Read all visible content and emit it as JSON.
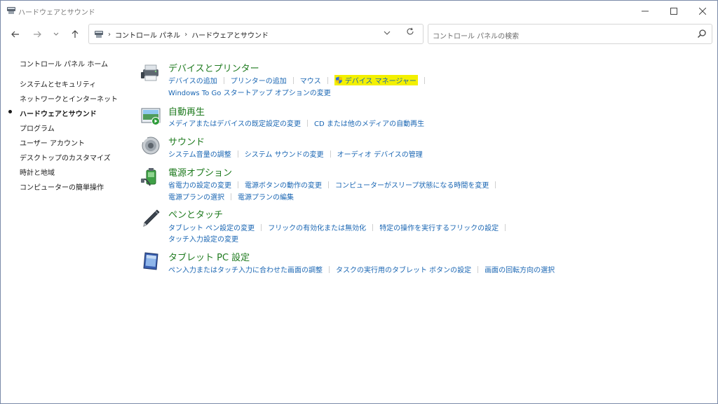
{
  "window": {
    "title": "ハードウェアとサウンド"
  },
  "address": {
    "crumbs": [
      "コントロール パネル",
      "ハードウェアとサウンド"
    ]
  },
  "search": {
    "placeholder": "コントロール パネルの検索"
  },
  "sidebar": {
    "items": [
      {
        "label": "コントロール パネル ホーム",
        "active": false
      },
      {
        "label": "システムとセキュリティ",
        "active": false
      },
      {
        "label": "ネットワークとインターネット",
        "active": false
      },
      {
        "label": "ハードウェアとサウンド",
        "active": true
      },
      {
        "label": "プログラム",
        "active": false
      },
      {
        "label": "ユーザー アカウント",
        "active": false
      },
      {
        "label": "デスクトップのカスタマイズ",
        "active": false
      },
      {
        "label": "時計と地域",
        "active": false
      },
      {
        "label": "コンピューターの簡単操作",
        "active": false
      }
    ]
  },
  "sections": [
    {
      "title": "デバイスとプリンター",
      "icon": "printer-icon",
      "rows": [
        [
          "デバイスの追加",
          "プリンターの追加",
          "マウス",
          "デバイス マネージャー"
        ],
        [
          "Windows To Go スタートアップ オプションの変更"
        ]
      ],
      "highlighted": "デバイス マネージャー"
    },
    {
      "title": "自動再生",
      "icon": "autoplay-icon",
      "rows": [
        [
          "メディアまたはデバイスの既定設定の変更",
          "CD または他のメディアの自動再生"
        ]
      ]
    },
    {
      "title": "サウンド",
      "icon": "speaker-icon",
      "rows": [
        [
          "システム音量の調整",
          "システム サウンドの変更",
          "オーディオ デバイスの管理"
        ]
      ]
    },
    {
      "title": "電源オプション",
      "icon": "power-options-icon",
      "rows": [
        [
          "省電力の設定の変更",
          "電源ボタンの動作の変更",
          "コンピューターがスリープ状態になる時間を変更"
        ],
        [
          "電源プランの選択",
          "電源プランの編集"
        ]
      ]
    },
    {
      "title": "ペンとタッチ",
      "icon": "pen-icon",
      "rows": [
        [
          "タブレット ペン設定の変更",
          "フリックの有効化または無効化",
          "特定の操作を実行するフリックの設定"
        ],
        [
          "タッチ入力設定の変更"
        ]
      ]
    },
    {
      "title": "タブレット PC 設定",
      "icon": "tablet-icon",
      "rows": [
        [
          "ペン入力またはタッチ入力に合わせた画面の調整",
          "タスクの実行用のタブレット ボタンの設定",
          "画面の回転方向の選択"
        ]
      ]
    }
  ],
  "colors": {
    "section_title": "#1e7a1e",
    "link": "#1a66b3",
    "highlight": "#f3f000"
  }
}
